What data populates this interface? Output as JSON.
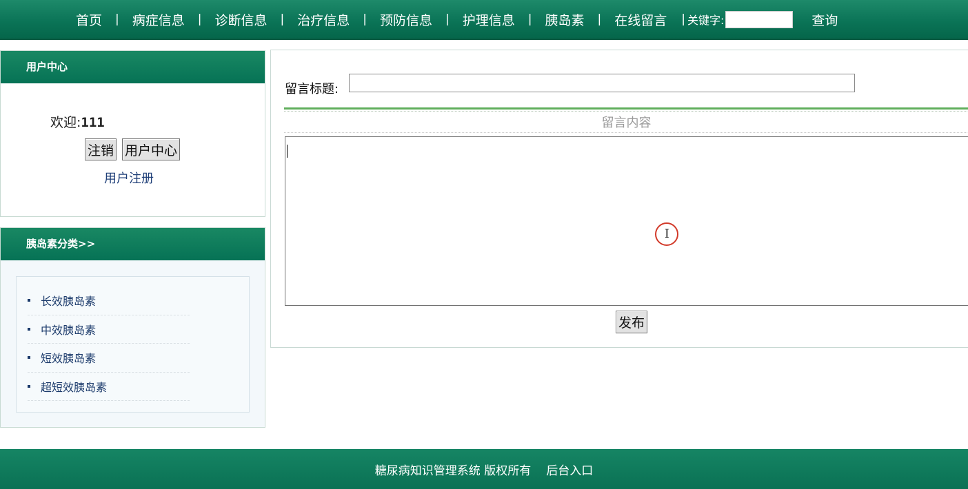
{
  "nav": {
    "items": [
      "首页",
      "病症信息",
      "诊断信息",
      "治疗信息",
      "预防信息",
      "护理信息",
      "胰岛素",
      "在线留言"
    ],
    "separator": "|",
    "keyword_label": "关键字:",
    "keyword_value": "",
    "search_label": "查询"
  },
  "user_center": {
    "title": "用户中心",
    "welcome_label": "欢迎:",
    "username": "111",
    "logout_label": "注销",
    "center_label": "用户中心",
    "register_label": "用户注册"
  },
  "categories": {
    "title": "胰岛素分类>>",
    "items": [
      "长效胰岛素",
      "中效胰岛素",
      "短效胰岛素",
      "超短效胰岛素"
    ]
  },
  "form": {
    "title_label": "留言标题:",
    "title_value": "",
    "content_label": "留言内容",
    "content_value": "",
    "submit_label": "发布"
  },
  "footer": {
    "copyright": "糖尿病知识管理系统 版权所有",
    "admin_link": "后台入口"
  },
  "cursor": {
    "icon": "i-beam-cursor-icon",
    "ibeam_glyph": "I"
  },
  "colors": {
    "header_green": "#0b7457",
    "rule_green": "#5fae5b",
    "link_blue": "#1b3a6b",
    "cursor_ring": "#d23a2a"
  }
}
